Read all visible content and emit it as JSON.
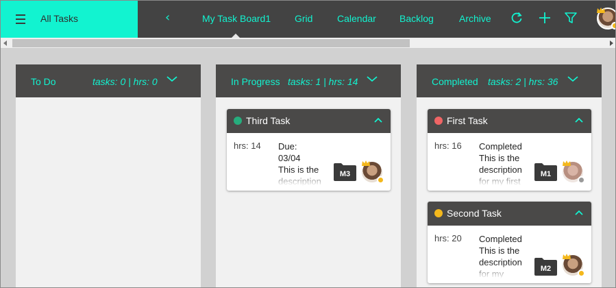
{
  "sidebar": {
    "title": "All Tasks"
  },
  "nav": {
    "back_glyph": "‹",
    "items": [
      {
        "label": "My Task Board1",
        "active": true
      },
      {
        "label": "Grid"
      },
      {
        "label": "Calendar"
      },
      {
        "label": "Backlog"
      },
      {
        "label": "Archive"
      }
    ],
    "icons": [
      "refresh-icon",
      "plus-icon",
      "filter-icon"
    ]
  },
  "colors": {
    "accent": "#12f3d0",
    "header_bg": "#434343",
    "column_head": "#4a4948",
    "dot_green": "#26ad7d",
    "dot_red": "#f06565",
    "dot_yellow": "#f4b81c"
  },
  "columns": [
    {
      "title": "To Do",
      "stats": "tasks: 0 | hrs: 0",
      "cards": []
    },
    {
      "title": "In Progress",
      "stats": "tasks: 1 | hrs: 14",
      "cards": [
        {
          "title": "Third Task",
          "dot": "green",
          "hrs": "hrs: 14",
          "desc": "Due:\n03/04\nThis is the\ndescription",
          "folder": "M3",
          "avatar_status": "yellow"
        }
      ]
    },
    {
      "title": "Completed",
      "stats": "tasks: 2 | hrs: 36",
      "cards": [
        {
          "title": "First Task",
          "dot": "red",
          "hrs": "hrs: 16",
          "desc": "Completed\nThis is the\ndescription\nfor my first",
          "folder": "M1",
          "avatar_status": "gray"
        },
        {
          "title": "Second Task",
          "dot": "yellow",
          "hrs": "hrs: 20",
          "desc": "Completed\nThis is the\ndescription\nfor my",
          "folder": "M2",
          "avatar_status": "yellow"
        }
      ]
    }
  ]
}
